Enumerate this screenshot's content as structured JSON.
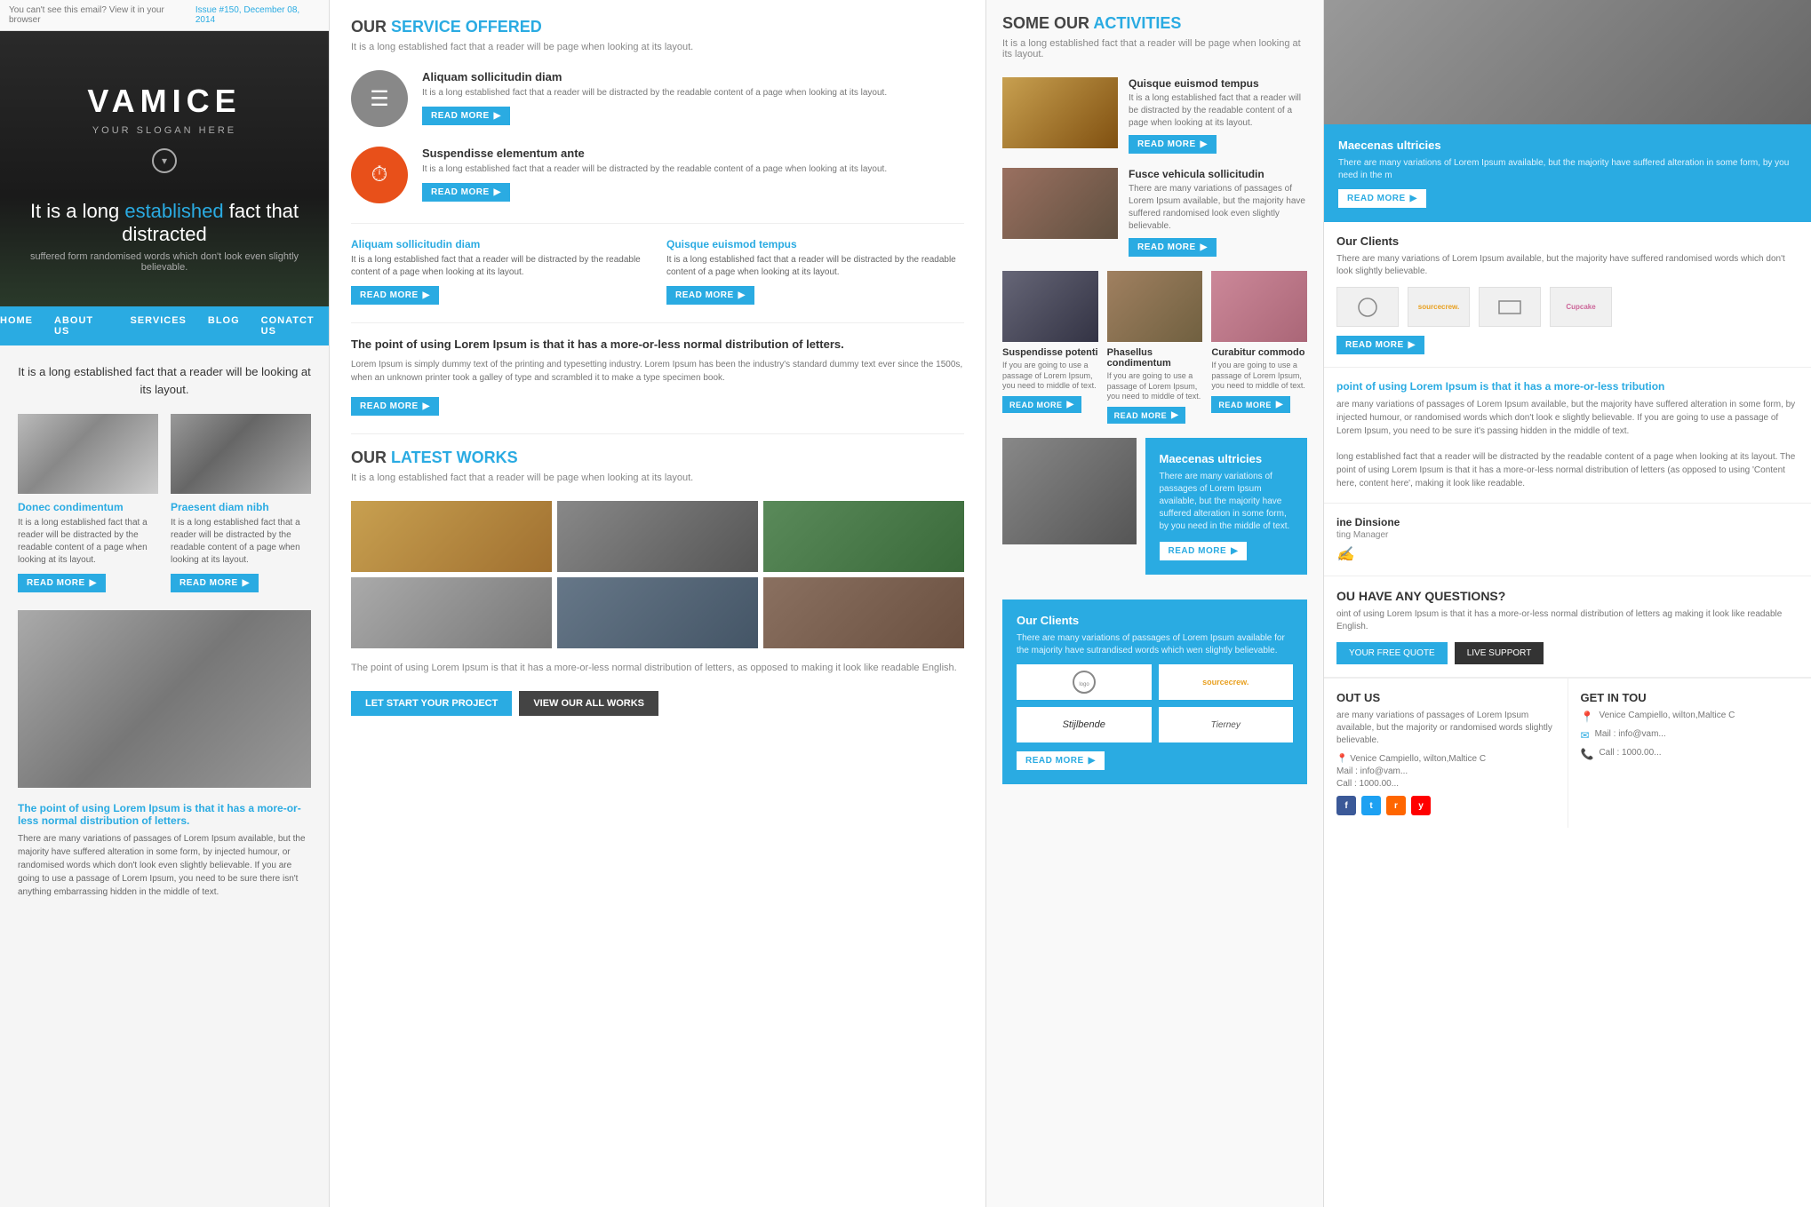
{
  "topbar": {
    "left_text": "You can't see this email? View it in your browser",
    "issue": "Issue #",
    "issue_num": "150",
    "date": "December 08, 2014"
  },
  "hero": {
    "title": "VAMICE",
    "slogan": "YOUR SLOGAN HERE",
    "tagline_pre": "It is a long ",
    "tagline_highlight": "established",
    "tagline_post": " fact that distracted",
    "sub": "suffered form randomised words which don't look even slightly believable."
  },
  "nav": {
    "items": [
      "HOME",
      "ABOUT US",
      "SERVICES",
      "BLOG",
      "CONATCT US"
    ]
  },
  "col1": {
    "intro": "It is a long established fact that a reader will be looking at its layout.",
    "cards": [
      {
        "title": "Donec condimentum",
        "text": "It is a long established fact that a reader will be distracted by the readable content of a page when looking at its layout.",
        "btn": "READ MORE"
      },
      {
        "title": "Praesent diam nibh",
        "text": "It is a long established fact that a reader will be distracted by the readable content of a page when looking at its layout.",
        "btn": "READ MORE"
      }
    ],
    "lorem_title": "The point of using Lorem Ipsum is that it has a more-or-less normal distribution of letters.",
    "lorem_text": "There are many variations of passages of Lorem Ipsum available, but the majority have suffered alteration in some form, by injected humour, or randomised words which don't look even slightly believable. If you are going to use a passage of Lorem Ipsum, you need to be sure there isn't anything embarrassing hidden in the middle of text."
  },
  "col2": {
    "services_title": "OUR ",
    "services_highlight": "SERVICE OFFERED",
    "services_sub": "It is a long established fact that a reader will be page when looking at its layout.",
    "services": [
      {
        "icon": "☰",
        "icon_type": "gray",
        "title": "Aliquam sollicitudin diam",
        "text": "It is a long established fact that a reader will be distracted by the readable content of a page when looking at its layout.",
        "btn": "READ MORE"
      },
      {
        "icon": "⏱",
        "icon_type": "orange",
        "title": "Suspendisse elementum ante",
        "text": "It is a long established fact that a reader will be distracted by the readable content of a page when looking at its layout.",
        "btn": "READ MORE"
      }
    ],
    "two_col": [
      {
        "title": "Aliquam sollicitudin diam",
        "text": "It is a long established fact that a reader will be distracted by the readable content of a page when looking at its layout.",
        "btn": "READ MORE"
      },
      {
        "title": "Quisque euismod tempus",
        "text": "It is a long established fact that a reader will be distracted by the readable content of a page when looking at its layout.",
        "btn": "READ MORE"
      }
    ],
    "big_section_title": "The point of using Lorem Ipsum is that it has a more-or-less normal distribution of letters.",
    "big_section_text": "Lorem Ipsum is simply dummy text of the printing and typesetting industry. Lorem Ipsum has been the industry's standard dummy text ever since the 1500s, when an unknown printer took a galley of type and scrambled it to make a type specimen book.",
    "big_section_btn": "READ MORE",
    "works_title": "OUR ",
    "works_highlight": "LATEST WORKS",
    "works_sub": "It is a long established fact that a reader will be page when looking at its layout.",
    "works_outro": "The point of using Lorem Ipsum is that it has a more-or-less normal distribution of letters, as opposed to making it look like readable English.",
    "cta_btn1": "LET START YOUR PROJECT",
    "cta_btn2": "VIEW OUR ALL WORKS"
  },
  "col3": {
    "title": "SOME OUR ",
    "title_highlight": "ACTIVITIES",
    "sub": "It is a long established fact that a reader will be page when looking at its layout.",
    "activities": [
      {
        "title": "Quisque euismod tempus",
        "text": "It is a long established fact that a reader will be distracted by the readable content of a page when looking at its layout.",
        "btn": "READ MORE"
      },
      {
        "title": "Fusce vehicula sollicitudin",
        "text": "There are many variations of passages of Lorem Ipsum available, but the majority have suffered randomised look even slightly believable.",
        "btn": "READ MORE"
      }
    ],
    "cards3": [
      {
        "title": "Suspendisse potenti",
        "text": "If you are going to use a passage of Lorem Ipsum, you need to middle of text.",
        "btn": "READ MORE"
      },
      {
        "title": "Phasellus condimentum",
        "text": "If you are going to use a passage of Lorem Ipsum, you need to middle of text.",
        "btn": "READ MORE"
      },
      {
        "title": "Curabitur commodo",
        "text": "If you are going to use a passage of Lorem Ipsum, you need to middle of text.",
        "btn": "READ MORE"
      }
    ],
    "blue_card_title": "Maecenas ultricies",
    "blue_card_text": "There are many variations of passages of Lorem Ipsum available, but the majority have suffered alteration in some form, by you need in the middle of text.",
    "blue_card_btn": "READ MORE",
    "clients_title": "Our Clients",
    "clients_text": "There are many variations of passages of Lorem Ipsum available for the majority have sutrandised words which wen slightly believable.",
    "clients_btn": "READ MORE",
    "client_logos": [
      "sourcecrew.",
      "Cupcake",
      "Stijlbende",
      "Tierney"
    ]
  },
  "col4": {
    "blue_title": "Maecenas ultricies",
    "blue_text": "There are many variations of Lorem Ipsum available, but the majority have suffered alteration in some form, by you need in the m",
    "blue_btn": "READ MORE",
    "clients_title": "Our Clients",
    "clients_text": "There are many variations of Lorem Ipsum available, but the majority have suffered randomised words which don't look slightly believable.",
    "clients_read_more": "READ MORE",
    "lorem_para_title": "point of using Lorem Ipsum is that it has a more-or-less tribution",
    "lorem_para_text": "are many variations of passages of Lorem Ipsum available, but the majority have suffered alteration in some form, by injected humour, or randomised words which don't look e slightly believable. If you are going to use a passage of Lorem Ipsum, you need to be sure it's passing hidden in the middle of text.",
    "lorem_para2": "long established fact that a reader will be distracted by the readable content of a page when looking at its layout. The point of using Lorem Ipsum is that it has a more-or-less normal distribution of letters (as opposed to using 'Content here, content here', making it look like readable.",
    "testi_name": "ine Dinsione",
    "testi_role": "ting Manager",
    "questions_title": "OU HAVE ANY QUESTIONS?",
    "questions_text": "oint of using Lorem Ipsum is that it has a more-or-less normal distribution of letters ag making it look like readable English.",
    "btn_quote": "YOUR FREE QUOTE",
    "btn_support": "LIVE SUPPORT",
    "about_title": "OUT US",
    "about_text": "are many variations of passages of Lorem Ipsum available, but the majority or randomised words slightly believable.",
    "about_mail": "Mail : info@vam...",
    "about_address": "Venice Campiello, wilton,Maltice C",
    "about_call": "Call : 1000.00...",
    "git_title": "GET IN TOU",
    "git_addr": "Venice Campiello, wilton,Maltice C",
    "git_mail": "Mail : info@vam...",
    "git_call": "Call : 1000.00...",
    "client_logos_right": [
      "sourcecrew.",
      "Cupcake",
      "Stijlbende",
      "Tierney"
    ]
  }
}
